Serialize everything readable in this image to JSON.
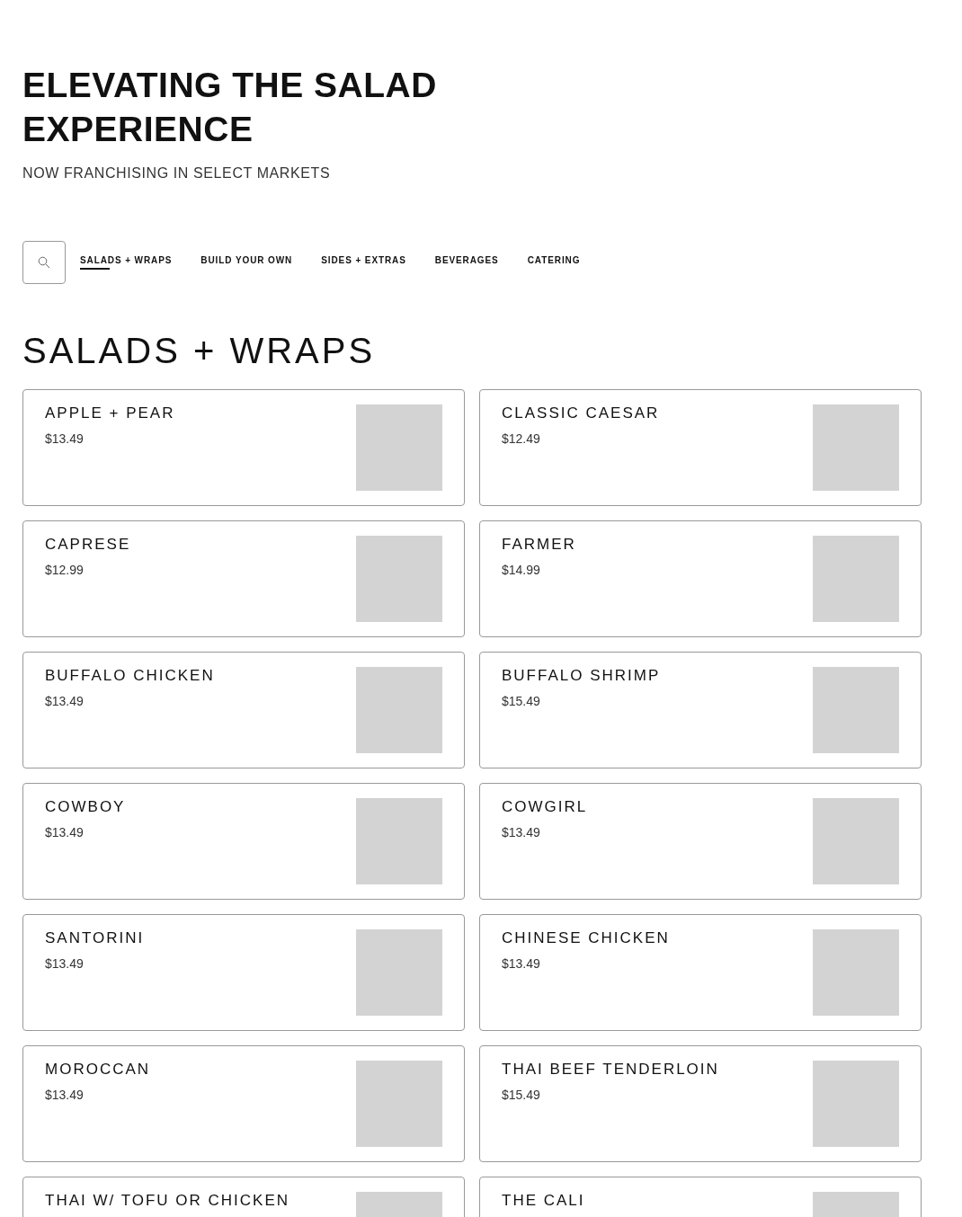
{
  "hero": {
    "title_lines": [
      "ELEVATING THE SALAD",
      "EXPERIENCE"
    ],
    "subtitle": "NOW FRANCHISING IN SELECT MARKETS"
  },
  "nav": {
    "tabs": [
      {
        "label": "SALADS + WRAPS",
        "selected": true
      },
      {
        "label": "BUILD YOUR OWN",
        "selected": false
      },
      {
        "label": "SIDES + EXTRAS",
        "selected": false
      },
      {
        "label": "BEVERAGES",
        "selected": false
      },
      {
        "label": "CATERING",
        "selected": false
      }
    ]
  },
  "section": {
    "title": "SALADS + WRAPS",
    "items": [
      {
        "name": "APPLE + PEAR",
        "price": "$13.49"
      },
      {
        "name": "CLASSIC CAESAR",
        "price": "$12.49"
      },
      {
        "name": "CAPRESE",
        "price": "$12.99"
      },
      {
        "name": "FARMER",
        "price": "$14.99"
      },
      {
        "name": "BUFFALO CHICKEN",
        "price": "$13.49"
      },
      {
        "name": "BUFFALO SHRIMP",
        "price": "$15.49"
      },
      {
        "name": "COWBOY",
        "price": "$13.49"
      },
      {
        "name": "COWGIRL",
        "price": "$13.49"
      },
      {
        "name": "SANTORINI",
        "price": "$13.49"
      },
      {
        "name": "CHINESE CHICKEN",
        "price": "$13.49"
      },
      {
        "name": "MOROCCAN",
        "price": "$13.49"
      },
      {
        "name": "THAI BEEF TENDERLOIN",
        "price": "$15.49"
      },
      {
        "name": "THAI W/ TOFU OR CHICKEN"
      },
      {
        "name": "THE CALI"
      }
    ]
  }
}
